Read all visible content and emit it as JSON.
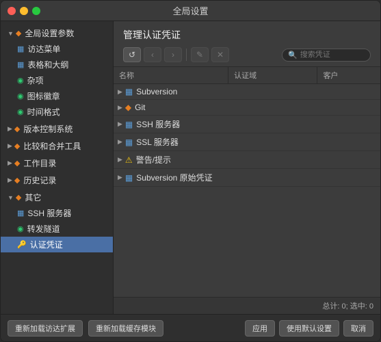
{
  "window": {
    "title": "全局设置"
  },
  "titlebar": {
    "buttons": {
      "close": "×",
      "minimize": "−",
      "maximize": "+"
    }
  },
  "sidebar": {
    "sections": [
      {
        "id": "global-settings",
        "label": "全局设置参数",
        "expanded": true,
        "icon": "◆",
        "iconColor": "icon-orange",
        "children": [
          {
            "id": "visit-menu",
            "label": "访达菜单",
            "icon": "▦",
            "iconColor": "icon-blue",
            "indent": true
          },
          {
            "id": "table-outline",
            "label": "表格和大纲",
            "icon": "▦",
            "iconColor": "icon-blue",
            "indent": true
          },
          {
            "id": "misc",
            "label": "杂项",
            "icon": "◉",
            "iconColor": "icon-green",
            "indent": true
          },
          {
            "id": "icon-badge",
            "label": "图标徽章",
            "icon": "◉",
            "iconColor": "icon-green",
            "indent": true
          },
          {
            "id": "time-format",
            "label": "时间格式",
            "icon": "◉",
            "iconColor": "icon-green",
            "indent": true
          }
        ]
      },
      {
        "id": "version-control",
        "label": "版本控制系统",
        "expanded": false,
        "icon": "◆",
        "iconColor": "icon-orange"
      },
      {
        "id": "diff-merge",
        "label": "比较和合并工具",
        "expanded": false,
        "icon": "◆",
        "iconColor": "icon-orange"
      },
      {
        "id": "work-dir",
        "label": "工作目录",
        "expanded": false,
        "icon": "◆",
        "iconColor": "icon-orange"
      },
      {
        "id": "history",
        "label": "历史记录",
        "expanded": false,
        "icon": "◆",
        "iconColor": "icon-orange"
      },
      {
        "id": "other",
        "label": "其它",
        "expanded": true,
        "icon": "◆",
        "iconColor": "icon-orange",
        "children": [
          {
            "id": "ssh-server",
            "label": "SSH 服务器",
            "icon": "▦",
            "iconColor": "icon-blue",
            "indent": true
          },
          {
            "id": "port-forward",
            "label": "转发隧道",
            "icon": "◉",
            "iconColor": "icon-green",
            "indent": true
          },
          {
            "id": "auth-cred",
            "label": "认证凭证",
            "icon": "🔑",
            "iconColor": "icon-yellow",
            "indent": true,
            "active": true
          }
        ]
      }
    ]
  },
  "panel": {
    "title": "管理认证凭证",
    "toolbar": {
      "refresh": "↺",
      "back": "‹",
      "forward": "›",
      "edit": "✎",
      "delete": "✕"
    },
    "search": {
      "placeholder": "搜索凭证"
    },
    "columns": [
      {
        "id": "name",
        "label": "名称"
      },
      {
        "id": "domain",
        "label": "认证域"
      },
      {
        "id": "client",
        "label": "客户"
      }
    ],
    "rows": [
      {
        "id": "subversion",
        "label": "Subversion",
        "icon": "▦",
        "iconColor": "icon-blue",
        "domain": "",
        "client": ""
      },
      {
        "id": "git",
        "label": "Git",
        "icon": "◆",
        "iconColor": "icon-orange",
        "domain": "",
        "client": ""
      },
      {
        "id": "ssh-server",
        "label": "SSH 服务器",
        "icon": "▦",
        "iconColor": "icon-blue",
        "domain": "",
        "client": ""
      },
      {
        "id": "ssl-server",
        "label": "SSL 服务器",
        "icon": "▦",
        "iconColor": "icon-blue",
        "domain": "",
        "client": ""
      },
      {
        "id": "warning",
        "label": "警告/提示",
        "icon": "⚠",
        "iconColor": "icon-yellow",
        "domain": "",
        "client": ""
      },
      {
        "id": "svn-original",
        "label": "Subversion 原始凭证",
        "icon": "▦",
        "iconColor": "icon-blue",
        "domain": "",
        "client": ""
      }
    ],
    "status": {
      "total": "总计: 0; 选中: 0"
    }
  },
  "statusbar": {
    "reload_extension": "重新加载访达扩展",
    "reload_cache": "重新加载缓存模块",
    "apply": "应用",
    "use_default": "使用默认设置",
    "cancel": "取消"
  }
}
